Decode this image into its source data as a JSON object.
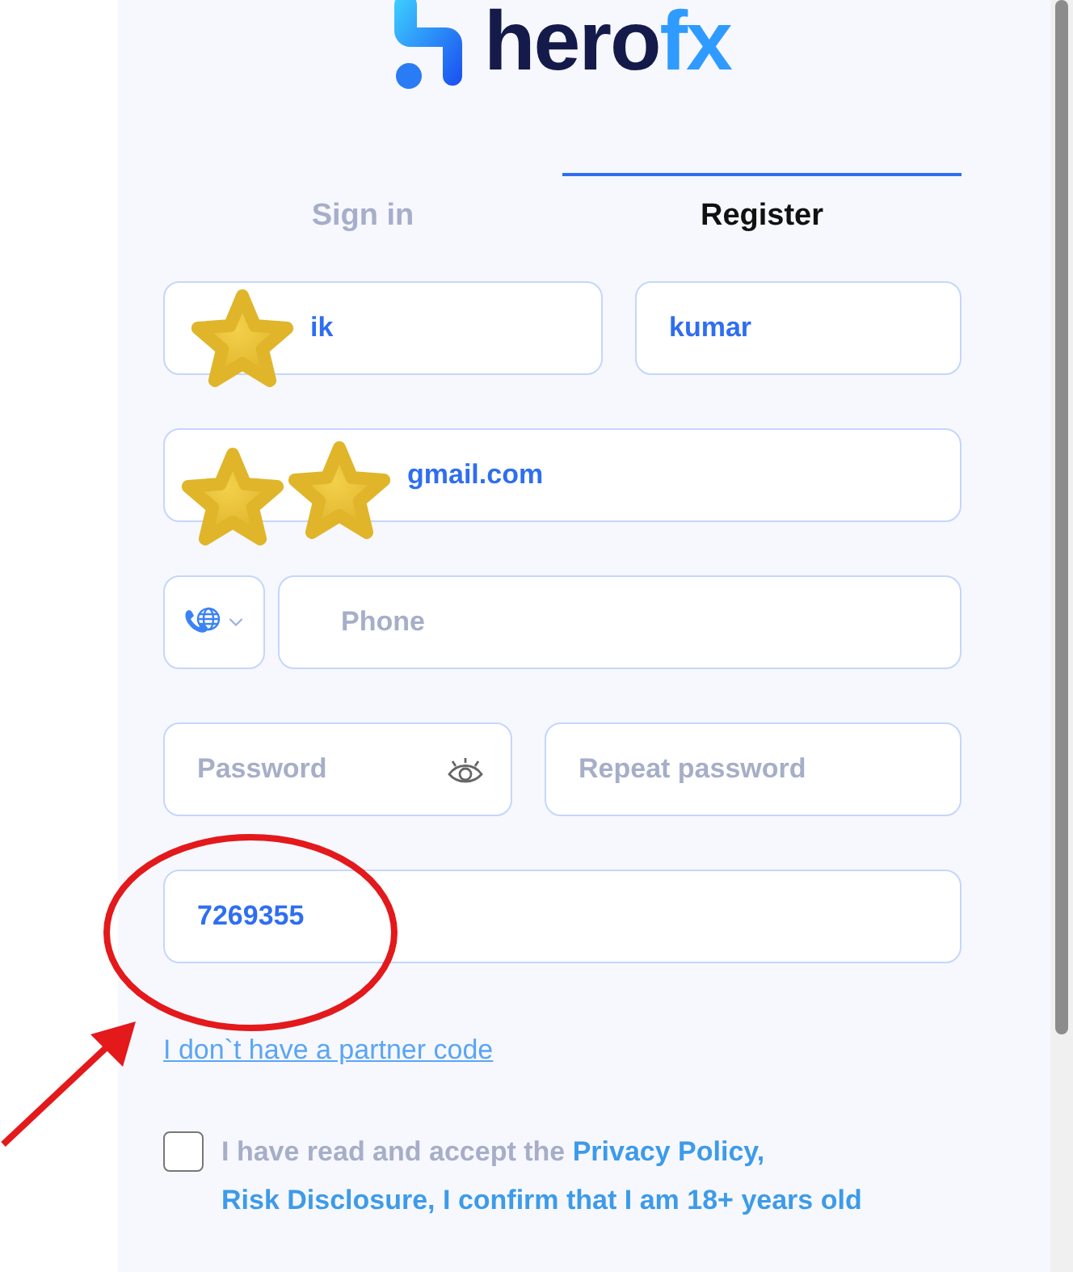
{
  "logo": {
    "text": "hero",
    "accent": "fx"
  },
  "tabs": [
    {
      "label": "Sign in",
      "selected": false
    },
    {
      "label": "Register",
      "selected": true
    }
  ],
  "form": {
    "first_name": {
      "value": "ik"
    },
    "last_name": {
      "value": "kumar"
    },
    "email": {
      "value": "gmail.com"
    },
    "phone": {
      "placeholder": "Phone"
    },
    "password": {
      "placeholder": "Password"
    },
    "repeat_password": {
      "placeholder": "Repeat password"
    },
    "partner_code": {
      "value": "7269355"
    }
  },
  "partner_link": "I don`t have a partner code",
  "consent": {
    "checked": false,
    "text": "I have read and accept the",
    "links": [
      "Privacy Policy,",
      "Risk Disclosure, I confirm that I am 18+ years old"
    ]
  }
}
